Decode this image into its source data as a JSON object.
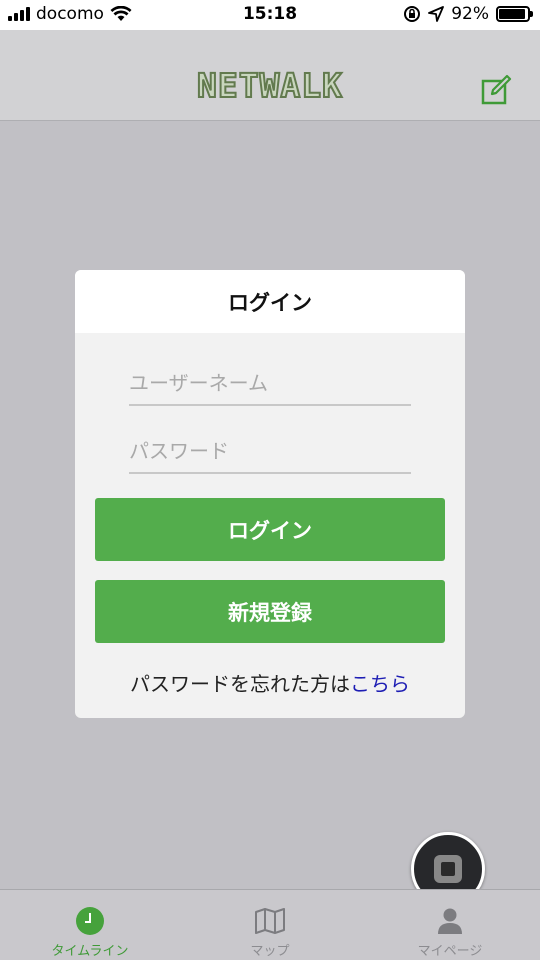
{
  "status_bar": {
    "carrier": "docomo",
    "time": "15:18",
    "battery_text": "92%",
    "battery_level": 0.92
  },
  "header": {
    "logo": "NETWALK",
    "compose_icon": "compose-icon"
  },
  "login_dialog": {
    "title": "ログイン",
    "username_placeholder": "ユーザーネーム",
    "password_placeholder": "パスワード",
    "login_button": "ログイン",
    "register_button": "新規登録",
    "forgot_text": "パスワードを忘れた方は",
    "forgot_link": "こちら"
  },
  "tabs": [
    {
      "label": "タイムライン",
      "icon": "clock-icon",
      "active": true
    },
    {
      "label": "マップ",
      "icon": "map-icon",
      "active": false
    },
    {
      "label": "マイページ",
      "icon": "person-icon",
      "active": false
    }
  ],
  "colors": {
    "accent_green": "#53ad4c",
    "link_blue": "#1e1eb4",
    "overlay_gray": "#c1c0c5"
  }
}
